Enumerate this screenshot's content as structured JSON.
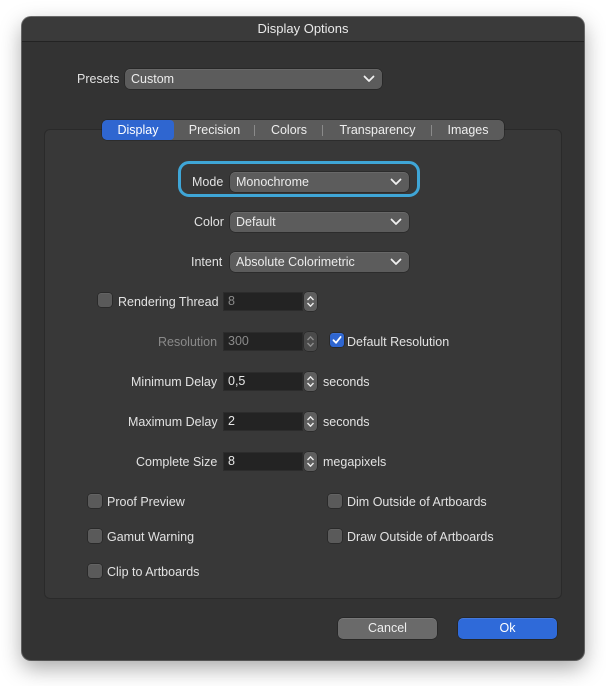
{
  "window": {
    "title": "Display Options"
  },
  "presets": {
    "label": "Presets",
    "value": "Custom"
  },
  "tabs": [
    {
      "label": "Display",
      "active": true
    },
    {
      "label": "Precision",
      "active": false
    },
    {
      "label": "Colors",
      "active": false
    },
    {
      "label": "Transparency",
      "active": false
    },
    {
      "label": "Images",
      "active": false
    }
  ],
  "display": {
    "mode": {
      "label": "Mode",
      "value": "Monochrome"
    },
    "color": {
      "label": "Color",
      "value": "Default"
    },
    "intent": {
      "label": "Intent",
      "value": "Absolute Colorimetric"
    },
    "rendering_thread": {
      "label": "Rendering Thread",
      "value": "8",
      "checked": false
    },
    "resolution": {
      "label": "Resolution",
      "value": "300",
      "default_label": "Default Resolution",
      "default_checked": true
    },
    "minimum_delay": {
      "label": "Minimum Delay",
      "value": "0,5",
      "unit": "seconds"
    },
    "maximum_delay": {
      "label": "Maximum Delay",
      "value": "2",
      "unit": "seconds"
    },
    "complete_size": {
      "label": "Complete Size",
      "value": "8",
      "unit": "megapixels"
    },
    "checkboxes": {
      "proof_preview": {
        "label": "Proof Preview",
        "checked": false
      },
      "gamut_warning": {
        "label": "Gamut Warning",
        "checked": false
      },
      "clip_to_artboards": {
        "label": "Clip to Artboards",
        "checked": false
      },
      "dim_outside": {
        "label": "Dim Outside of Artboards",
        "checked": false
      },
      "draw_outside": {
        "label": "Draw Outside of Artboards",
        "checked": false
      }
    }
  },
  "buttons": {
    "cancel": "Cancel",
    "ok": "Ok"
  },
  "colors": {
    "accent": "#2f66d0",
    "focus_ring": "#3fa6d7",
    "window_bg": "#333333"
  }
}
